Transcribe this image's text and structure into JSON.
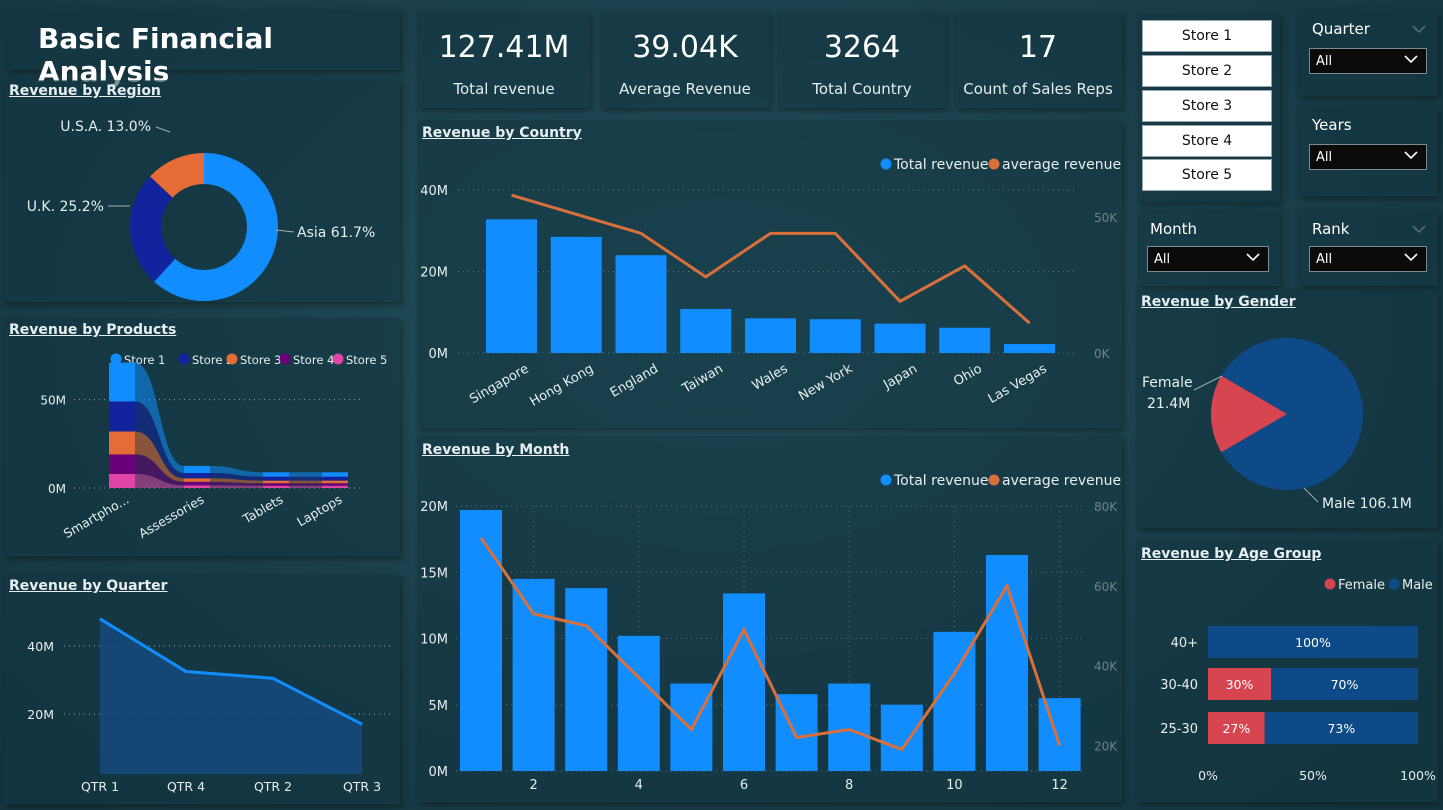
{
  "title": "Basic Financial Analysis",
  "kpis": [
    {
      "value": "127.41M",
      "label": "Total revenue"
    },
    {
      "value": "39.04K",
      "label": "Average Revenue"
    },
    {
      "value": "3264",
      "label": "Total Country"
    },
    {
      "value": "17",
      "label": "Count of Sales Reps"
    }
  ],
  "stores": [
    "Store 1",
    "Store 2",
    "Store 3",
    "Store 4",
    "Store 5"
  ],
  "slicers": {
    "quarter": {
      "title": "Quarter",
      "value": "All"
    },
    "years": {
      "title": "Years",
      "value": "All"
    },
    "month": {
      "title": "Month",
      "value": "All"
    },
    "rank": {
      "title": "Rank",
      "value": "All"
    }
  },
  "panel_titles": {
    "region": "Revenue by Region",
    "products": "Revenue by Products",
    "quarter": "Revenue by Quarter",
    "country": "Revenue by Country",
    "month": "Revenue by Month",
    "gender": "Revenue by Gender",
    "age": "Revenue by Age Group"
  },
  "colors": {
    "blue": "#118dff",
    "navy": "#12239e",
    "orange": "#e66c37",
    "purple": "#6b007b",
    "pink": "#e044a7",
    "dark_blue": "#0e4a87",
    "red": "#d64550",
    "line_orange": "#d9703c"
  },
  "chart_data": [
    {
      "id": "region",
      "type": "pie",
      "variant": "donut",
      "title": "Revenue by Region",
      "labels": [
        "Asia",
        "U.K.",
        "U.S.A."
      ],
      "values": [
        61.7,
        25.2,
        13.0
      ],
      "data_labels": [
        "Asia 61.7%",
        "U.K. 25.2%",
        "U.S.A. 13.0%"
      ],
      "colors": [
        "#118dff",
        "#12239e",
        "#e66c37"
      ]
    },
    {
      "id": "products",
      "type": "area",
      "variant": "ribbon",
      "title": "Revenue by Products",
      "categories": [
        "Smartpho...",
        "Assessories",
        "Tablets",
        "Laptops"
      ],
      "series": [
        {
          "name": "Store 1",
          "values": [
            22,
            4,
            2.5,
            2.5
          ]
        },
        {
          "name": "Store 2",
          "values": [
            17,
            3,
            2.2,
            2.2
          ]
        },
        {
          "name": "Store 3",
          "values": [
            13,
            2,
            1.5,
            1.5
          ]
        },
        {
          "name": "Store 4",
          "values": [
            11,
            2,
            1.4,
            1.4
          ]
        },
        {
          "name": "Store 5",
          "values": [
            8,
            1.5,
            1.3,
            1.3
          ]
        }
      ],
      "yticks": [
        "0M",
        "50M"
      ],
      "ylim": [
        0,
        60
      ],
      "legend": "top"
    },
    {
      "id": "quarter",
      "type": "area",
      "title": "Revenue by Quarter",
      "categories": [
        "QTR 1",
        "QTR 4",
        "QTR 2",
        "QTR 3"
      ],
      "values": [
        48,
        32.5,
        30.5,
        17
      ],
      "yticks": [
        "20M",
        "40M"
      ],
      "ylim": [
        10,
        50
      ]
    },
    {
      "id": "country",
      "type": "bar",
      "combo": "line",
      "title": "Revenue by Country",
      "categories": [
        "Singapore",
        "Hong Kong",
        "England",
        "Taiwan",
        "Wales",
        "New York",
        "Japan",
        "Ohio",
        "Las Vegas"
      ],
      "series": [
        {
          "name": "Total revenue",
          "type": "bar",
          "axis": "left",
          "values": [
            32.8,
            28.5,
            24,
            10.8,
            8.5,
            8.3,
            7.2,
            6.2,
            2.2
          ]
        },
        {
          "name": "average revenue",
          "type": "line",
          "axis": "right",
          "values": [
            58,
            51,
            44,
            28,
            44,
            44,
            19,
            32,
            11
          ]
        }
      ],
      "left_ticks": [
        "0M",
        "20M",
        "40M"
      ],
      "right_ticks": [
        "0K",
        "50K"
      ],
      "ylim_left": [
        0,
        40
      ],
      "ylim_right": [
        0,
        50
      ],
      "legend": "top-right"
    },
    {
      "id": "month",
      "type": "bar",
      "combo": "line",
      "title": "Revenue by Month",
      "categories": [
        1,
        2,
        3,
        4,
        5,
        6,
        7,
        8,
        9,
        10,
        11,
        12
      ],
      "x_tick_labels": [
        "2",
        "4",
        "6",
        "8",
        "10",
        "12"
      ],
      "series": [
        {
          "name": "Total revenue",
          "type": "bar",
          "axis": "left",
          "values": [
            19.7,
            14.5,
            13.8,
            10.2,
            6.6,
            13.4,
            5.8,
            6.6,
            5.0,
            10.5,
            16.3,
            5.5
          ]
        },
        {
          "name": "average revenue",
          "type": "line",
          "axis": "right",
          "values": [
            72,
            53,
            50,
            37,
            24,
            49,
            22,
            24,
            19,
            38,
            60,
            20
          ]
        }
      ],
      "left_ticks": [
        "0M",
        "5M",
        "10M",
        "15M",
        "20M"
      ],
      "right_ticks": [
        "20K",
        "40K",
        "60K",
        "80K"
      ],
      "ylim_left": [
        0,
        20
      ],
      "ylim_right": [
        13.6,
        80
      ],
      "legend": "top-right"
    },
    {
      "id": "gender",
      "type": "pie",
      "title": "Revenue by Gender",
      "labels": [
        "Female",
        "Male"
      ],
      "values": [
        21.4,
        106.1
      ],
      "data_labels": [
        "Female",
        "21.4M",
        "Male 106.1M"
      ],
      "colors": [
        "#d64550",
        "#0e4a87"
      ]
    },
    {
      "id": "age",
      "type": "bar",
      "variant": "100% stacked horizontal",
      "title": "Revenue by Age Group",
      "categories": [
        "40+",
        "30-40",
        "25-30"
      ],
      "series": [
        {
          "name": "Female",
          "values": [
            0,
            30,
            27
          ]
        },
        {
          "name": "Male",
          "values": [
            100,
            70,
            73
          ]
        }
      ],
      "xticks": [
        "0%",
        "50%",
        "100%"
      ],
      "legend": "top-right"
    }
  ]
}
